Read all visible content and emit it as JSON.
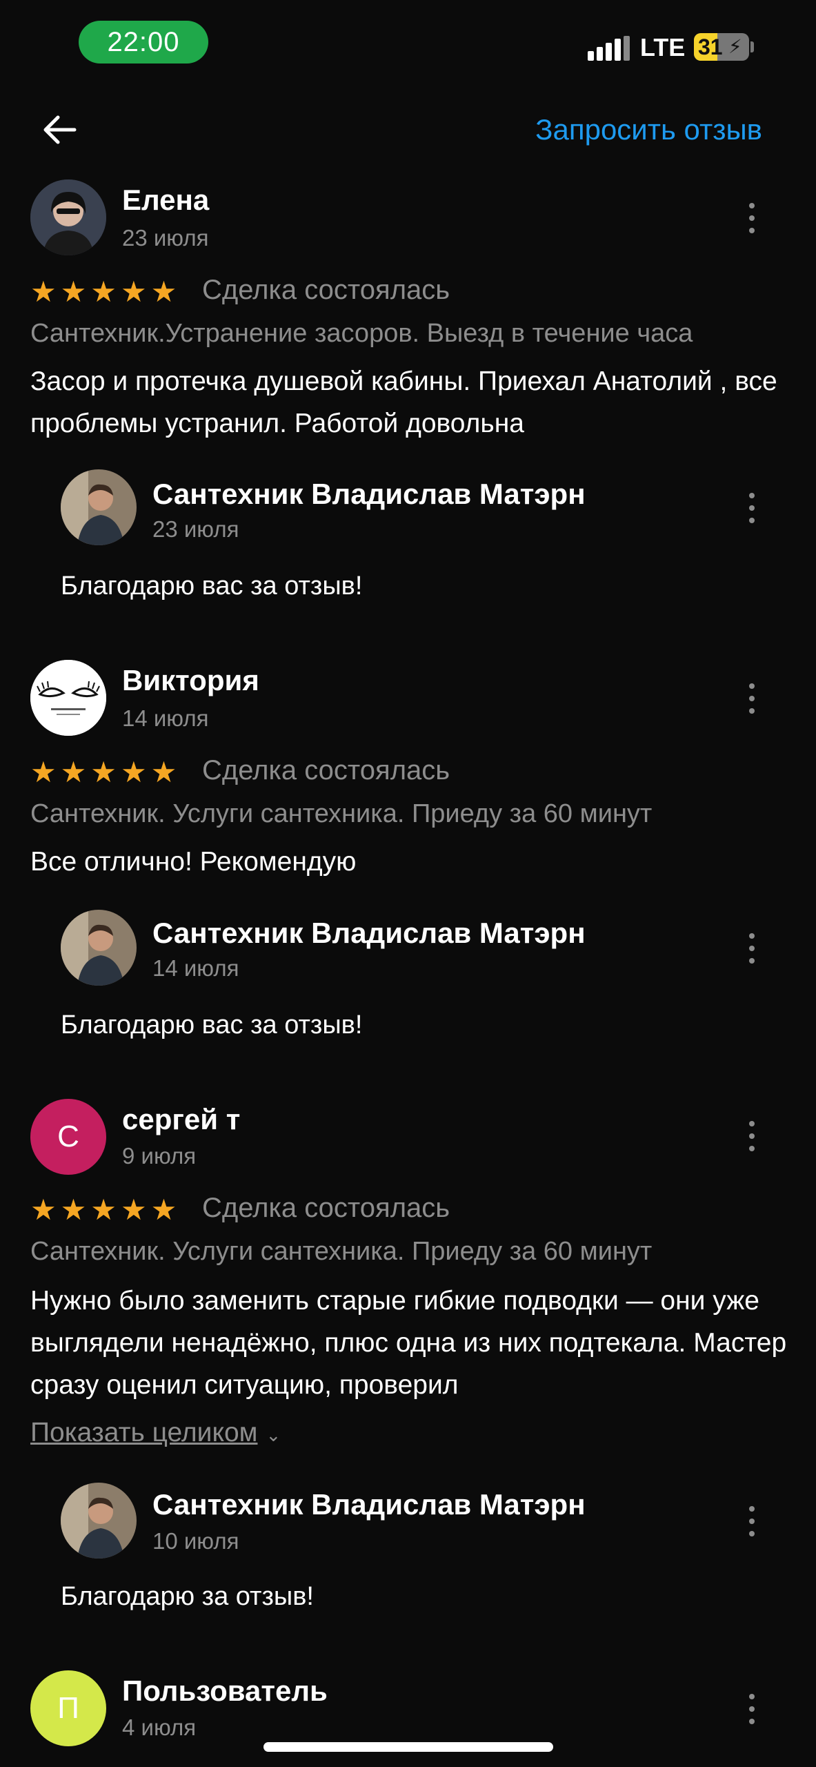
{
  "status_bar": {
    "time": "22:00",
    "network": "LTE",
    "battery": "31"
  },
  "header": {
    "request_review": "Запросить отзыв"
  },
  "reviews": [
    {
      "name": "Елена",
      "date": "23 июля",
      "stars": "★★★★★",
      "deal": "Сделка состоялась",
      "service": "Сантехник.Устранение засоров. Выезд в течение часа",
      "text": "Засор и протечка душевой кабины. Приехал Анатолий , все проблемы устранил. Работой довольна",
      "reply": {
        "name": "Сантехник Владислав Матэрн",
        "date": "23 июля",
        "text": "Благодарю вас за отзыв!"
      }
    },
    {
      "name": "Виктория",
      "date": "14 июля",
      "stars": "★★★★★",
      "deal": "Сделка состоялась",
      "service": "Сантехник. Услуги сантехника. Приеду за 60 минут",
      "text": "Все отлично! Рекомендую",
      "reply": {
        "name": "Сантехник Владислав Матэрн",
        "date": "14 июля",
        "text": "Благодарю вас за отзыв!"
      }
    },
    {
      "name": "сергей т",
      "avatar_letter": "С",
      "date": "9 июля",
      "stars": "★★★★★",
      "deal": "Сделка состоялась",
      "service": "Сантехник. Услуги сантехника. Приеду за 60 минут",
      "text": "Нужно было заменить старые гибкие подводки — они уже выглядели ненадёжно, плюс одна из них подтекала. Мастер сразу оценил ситуацию, проверил",
      "show_all": "Показать целиком",
      "reply": {
        "name": "Сантехник Владислав Матэрн",
        "date": "10 июля",
        "text": "Благодарю за отзыв!"
      }
    },
    {
      "name": "Пользователь",
      "avatar_letter": "П",
      "date": "4 июля"
    }
  ],
  "colors": {
    "background": "#0b0b0b",
    "accent_link": "#1e9bf0",
    "star": "#f5a623",
    "muted_text": "#8d8d8d",
    "time_pill": "#1fa84a",
    "avatar_sergey": "#c41f5f",
    "avatar_user": "#d4e84a"
  }
}
